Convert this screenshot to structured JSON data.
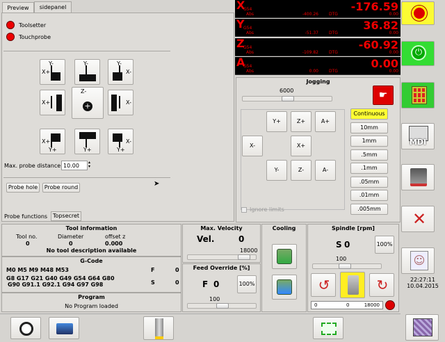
{
  "tabs": {
    "preview": "Preview",
    "sidepanel": "sidepanel"
  },
  "probe": {
    "toolsetter": "Toolsetter",
    "touchprobe": "Touchprobe",
    "buttons": [
      {
        "top": "Y-",
        "left": "X+",
        "right": "",
        "bottom": ""
      },
      {
        "top": "Y-",
        "left": "",
        "right": "",
        "bottom": ""
      },
      {
        "top": "Y-",
        "left": "",
        "right": "X-",
        "bottom": ""
      },
      {
        "top": "",
        "left": "X+",
        "right": "",
        "bottom": ""
      },
      {
        "top": "Z-",
        "left": "",
        "right": "",
        "bottom": ""
      },
      {
        "top": "",
        "left": "",
        "right": "X-",
        "bottom": ""
      },
      {
        "top": "",
        "left": "X+",
        "right": "",
        "bottom": "Y+"
      },
      {
        "top": "",
        "left": "",
        "right": "",
        "bottom": "Y+"
      },
      {
        "top": "",
        "left": "",
        "right": "X-",
        "bottom": "Y+"
      }
    ],
    "max_distance_label": "Max. probe distance",
    "max_distance_value": "10.00",
    "probe_hole": "Probe hole",
    "probe_round": "Probe round",
    "functions_label": "Probe functions",
    "functions_tab": "Topsecret"
  },
  "dro": [
    {
      "axis": "X",
      "g": "G54",
      "value": "-176.59",
      "abs_label": "Abs",
      "abs": "-400.26",
      "dtg_label": "DTG",
      "dtg": "0.00"
    },
    {
      "axis": "Y",
      "g": "G54",
      "value": "36.82",
      "abs_label": "Abs",
      "abs": "-51.37",
      "dtg_label": "DTG",
      "dtg": "0.00"
    },
    {
      "axis": "Z",
      "g": "G54",
      "value": "-60.92",
      "abs_label": "Abs",
      "abs": "-109.82",
      "dtg_label": "DTG",
      "dtg": "0.00"
    },
    {
      "axis": "A",
      "g": "G54",
      "value": "0.00",
      "abs_label": "Abs",
      "abs": "0.00",
      "dtg_label": "DTG",
      "dtg": "0.00"
    }
  ],
  "jogging": {
    "title": "Jogging",
    "speed": "6000",
    "speed_fraction": 0.5,
    "buttons": {
      "yp": "Y+",
      "zp": "Z+",
      "ap": "A+",
      "xm": "X-",
      "xp": "X+",
      "ym": "Y-",
      "zm": "Z-",
      "am": "A-"
    },
    "increments": [
      "Continuous",
      "10mm",
      "1mm",
      ".5mm",
      ".1mm",
      ".05mm",
      ".01mm",
      ".005mm"
    ],
    "ignore_limits": "Ignore limits"
  },
  "tool": {
    "title": "Tool information",
    "no_label": "Tool no.",
    "diam_label": "Diameter",
    "offset_label": "offset z",
    "no": "0",
    "diam": "0",
    "offset": "0.000",
    "desc": "No tool description available"
  },
  "gcode": {
    "title": "G-Code",
    "line1": "M0 M5 M9 M48 M53",
    "line2": "G8 G17 G21 G40 G49 G54 G64 G80",
    "line3": "G90 G91.1 G92.1 G94 G97 G98",
    "f_label": "F",
    "f_value": "0",
    "s_label": "S",
    "s_value": "0"
  },
  "program": {
    "title": "Program",
    "status": "No Program loaded"
  },
  "velocity": {
    "title": "Max. Velocity",
    "label": "Vel.",
    "value": "0",
    "max": "18000",
    "fraction": 0.88
  },
  "feed": {
    "title": "Feed Override [%]",
    "label": "F",
    "value": "0",
    "pct_button": "100%",
    "scale": "100",
    "fraction": 0.5
  },
  "cooling": {
    "title": "Cooling"
  },
  "spindle": {
    "title": "Spindle [rpm]",
    "label": "S",
    "value": "0",
    "pct_button": "100%",
    "scale": "100",
    "fraction": 0.45,
    "bar_min": "0",
    "bar_mid": "0",
    "bar_max": "18000"
  },
  "clock": {
    "time": "22:27:11",
    "date": "10.04.2015"
  },
  "mdi_label": "MDI",
  "colors": {
    "dro_text": "#ee0000",
    "active_increment": "#ffff33",
    "estop": "#d00000",
    "power": "#00aa00"
  }
}
